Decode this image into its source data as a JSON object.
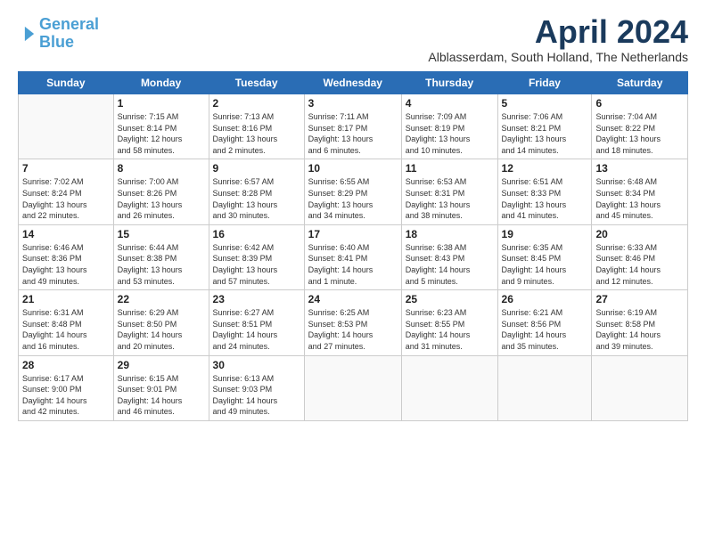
{
  "header": {
    "logo_line1": "General",
    "logo_line2": "Blue",
    "month_title": "April 2024",
    "location": "Alblasserdam, South Holland, The Netherlands"
  },
  "weekdays": [
    "Sunday",
    "Monday",
    "Tuesday",
    "Wednesday",
    "Thursday",
    "Friday",
    "Saturday"
  ],
  "weeks": [
    [
      {
        "day": "",
        "info": ""
      },
      {
        "day": "1",
        "info": "Sunrise: 7:15 AM\nSunset: 8:14 PM\nDaylight: 12 hours\nand 58 minutes."
      },
      {
        "day": "2",
        "info": "Sunrise: 7:13 AM\nSunset: 8:16 PM\nDaylight: 13 hours\nand 2 minutes."
      },
      {
        "day": "3",
        "info": "Sunrise: 7:11 AM\nSunset: 8:17 PM\nDaylight: 13 hours\nand 6 minutes."
      },
      {
        "day": "4",
        "info": "Sunrise: 7:09 AM\nSunset: 8:19 PM\nDaylight: 13 hours\nand 10 minutes."
      },
      {
        "day": "5",
        "info": "Sunrise: 7:06 AM\nSunset: 8:21 PM\nDaylight: 13 hours\nand 14 minutes."
      },
      {
        "day": "6",
        "info": "Sunrise: 7:04 AM\nSunset: 8:22 PM\nDaylight: 13 hours\nand 18 minutes."
      }
    ],
    [
      {
        "day": "7",
        "info": "Sunrise: 7:02 AM\nSunset: 8:24 PM\nDaylight: 13 hours\nand 22 minutes."
      },
      {
        "day": "8",
        "info": "Sunrise: 7:00 AM\nSunset: 8:26 PM\nDaylight: 13 hours\nand 26 minutes."
      },
      {
        "day": "9",
        "info": "Sunrise: 6:57 AM\nSunset: 8:28 PM\nDaylight: 13 hours\nand 30 minutes."
      },
      {
        "day": "10",
        "info": "Sunrise: 6:55 AM\nSunset: 8:29 PM\nDaylight: 13 hours\nand 34 minutes."
      },
      {
        "day": "11",
        "info": "Sunrise: 6:53 AM\nSunset: 8:31 PM\nDaylight: 13 hours\nand 38 minutes."
      },
      {
        "day": "12",
        "info": "Sunrise: 6:51 AM\nSunset: 8:33 PM\nDaylight: 13 hours\nand 41 minutes."
      },
      {
        "day": "13",
        "info": "Sunrise: 6:48 AM\nSunset: 8:34 PM\nDaylight: 13 hours\nand 45 minutes."
      }
    ],
    [
      {
        "day": "14",
        "info": "Sunrise: 6:46 AM\nSunset: 8:36 PM\nDaylight: 13 hours\nand 49 minutes."
      },
      {
        "day": "15",
        "info": "Sunrise: 6:44 AM\nSunset: 8:38 PM\nDaylight: 13 hours\nand 53 minutes."
      },
      {
        "day": "16",
        "info": "Sunrise: 6:42 AM\nSunset: 8:39 PM\nDaylight: 13 hours\nand 57 minutes."
      },
      {
        "day": "17",
        "info": "Sunrise: 6:40 AM\nSunset: 8:41 PM\nDaylight: 14 hours\nand 1 minute."
      },
      {
        "day": "18",
        "info": "Sunrise: 6:38 AM\nSunset: 8:43 PM\nDaylight: 14 hours\nand 5 minutes."
      },
      {
        "day": "19",
        "info": "Sunrise: 6:35 AM\nSunset: 8:45 PM\nDaylight: 14 hours\nand 9 minutes."
      },
      {
        "day": "20",
        "info": "Sunrise: 6:33 AM\nSunset: 8:46 PM\nDaylight: 14 hours\nand 12 minutes."
      }
    ],
    [
      {
        "day": "21",
        "info": "Sunrise: 6:31 AM\nSunset: 8:48 PM\nDaylight: 14 hours\nand 16 minutes."
      },
      {
        "day": "22",
        "info": "Sunrise: 6:29 AM\nSunset: 8:50 PM\nDaylight: 14 hours\nand 20 minutes."
      },
      {
        "day": "23",
        "info": "Sunrise: 6:27 AM\nSunset: 8:51 PM\nDaylight: 14 hours\nand 24 minutes."
      },
      {
        "day": "24",
        "info": "Sunrise: 6:25 AM\nSunset: 8:53 PM\nDaylight: 14 hours\nand 27 minutes."
      },
      {
        "day": "25",
        "info": "Sunrise: 6:23 AM\nSunset: 8:55 PM\nDaylight: 14 hours\nand 31 minutes."
      },
      {
        "day": "26",
        "info": "Sunrise: 6:21 AM\nSunset: 8:56 PM\nDaylight: 14 hours\nand 35 minutes."
      },
      {
        "day": "27",
        "info": "Sunrise: 6:19 AM\nSunset: 8:58 PM\nDaylight: 14 hours\nand 39 minutes."
      }
    ],
    [
      {
        "day": "28",
        "info": "Sunrise: 6:17 AM\nSunset: 9:00 PM\nDaylight: 14 hours\nand 42 minutes."
      },
      {
        "day": "29",
        "info": "Sunrise: 6:15 AM\nSunset: 9:01 PM\nDaylight: 14 hours\nand 46 minutes."
      },
      {
        "day": "30",
        "info": "Sunrise: 6:13 AM\nSunset: 9:03 PM\nDaylight: 14 hours\nand 49 minutes."
      },
      {
        "day": "",
        "info": ""
      },
      {
        "day": "",
        "info": ""
      },
      {
        "day": "",
        "info": ""
      },
      {
        "day": "",
        "info": ""
      }
    ]
  ]
}
